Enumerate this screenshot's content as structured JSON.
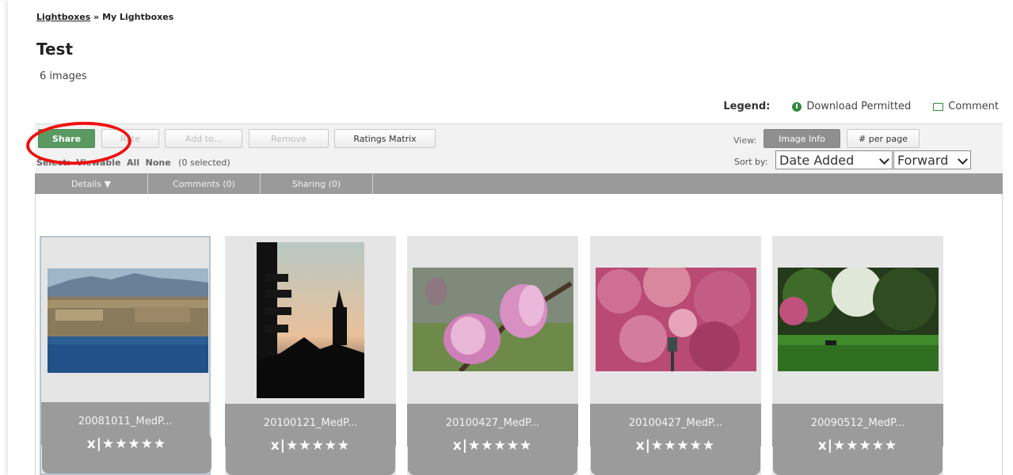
{
  "breadcrumb": {
    "root": "Lightboxes",
    "separator": "»",
    "current": "My Lightboxes"
  },
  "title": "Test",
  "image_count": "6 images",
  "legend": {
    "label": "Legend:",
    "download": "Download Permitted",
    "comment": "Comment",
    "download_icon": "download-permitted-icon",
    "comment_icon": "comment-icon"
  },
  "toolbar": {
    "share": "Share",
    "rate": "Rate",
    "add_to": "Add to...",
    "remove": "Remove",
    "ratings_matrix": "Ratings Matrix",
    "select_label": "Select:",
    "select_viewable": "Viewable",
    "select_all": "All",
    "select_none": "None",
    "selected_count": "(0 selected)",
    "view_label": "View:",
    "image_info": "Image Info",
    "per_page": "# per page",
    "sort_label": "Sort by:",
    "sort_value": "Date Added",
    "direction_value": "Forward"
  },
  "tabs": {
    "details": "Details ▼",
    "comments": "Comments (0)",
    "sharing": "Sharing (0)"
  },
  "images": [
    {
      "name": "20081011_MedP...",
      "rating": "x|★★★★★",
      "selected": true
    },
    {
      "name": "20100121_MedP...",
      "rating": "x|★★★★★",
      "selected": false
    },
    {
      "name": "20100427_MedP...",
      "rating": "x|★★★★★",
      "selected": false
    },
    {
      "name": "20100427_MedP...",
      "rating": "x|★★★★★",
      "selected": false
    },
    {
      "name": "20090512_MedP...",
      "rating": "x|★★★★★",
      "selected": false
    }
  ],
  "colors": {
    "share_green": "#5a9a62",
    "annotation_red": "#e11111",
    "tab_gray": "#9a9a9a",
    "card_gray": "#e5e5e5"
  }
}
